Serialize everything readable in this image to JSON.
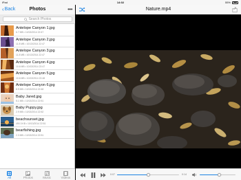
{
  "status_bar": {
    "carrier": "iPad",
    "time": "14:02",
    "battery": "55%"
  },
  "left_panel": {
    "back_label": "Back",
    "title": "Photos",
    "search_placeholder": "Search Photos",
    "files": [
      {
        "name": "Antelope Canyon 1.jpg",
        "meta": "6.7 MB • 10/13/2014 22:47"
      },
      {
        "name": "Antelope Canyon 2.jpg",
        "meta": "11.8 MB • 10/13/2014 22:47"
      },
      {
        "name": "Antelope Canyon 3.jpg",
        "meta": "11.8 MB • 10/13/2014 22:47"
      },
      {
        "name": "Antelope Canyon 4.jpg",
        "meta": "10.6 MB • 10/13/2014 22:47"
      },
      {
        "name": "Antelope Canyon 5.jpg",
        "meta": "10.6 MB • 10/13/2014 22:48"
      },
      {
        "name": "Antelope Canyon 6.jpg",
        "meta": "8.9 MB • 10/13/2014 22:48"
      },
      {
        "name": "Baby Jared.jpg",
        "meta": "5.1 MB • 10/13/2014 22:51"
      },
      {
        "name": "Baby Puppy.jpg",
        "meta": "2.9 MB • 10/13/2014 22:52"
      },
      {
        "name": "beachsunset.jpg",
        "meta": "490.3 KB • 10/13/2014 22:51"
      },
      {
        "name": "bearfishing.jpg",
        "meta": "2.3 MB • 10/13/2014 22:51"
      }
    ],
    "tabs": [
      {
        "label": "All",
        "icon": "grid-icon",
        "active": true
      },
      {
        "label": "Photos",
        "icon": "photo-icon",
        "active": false
      },
      {
        "label": "Music",
        "icon": "music-icon",
        "active": false
      },
      {
        "label": "Videos",
        "icon": "film-icon",
        "active": false
      }
    ]
  },
  "player": {
    "title": "Nature.mp4",
    "elapsed": "0:07",
    "remaining": "0:14",
    "progress": 0.5,
    "volume": 0.55,
    "accent_color": "#1a82e2"
  }
}
